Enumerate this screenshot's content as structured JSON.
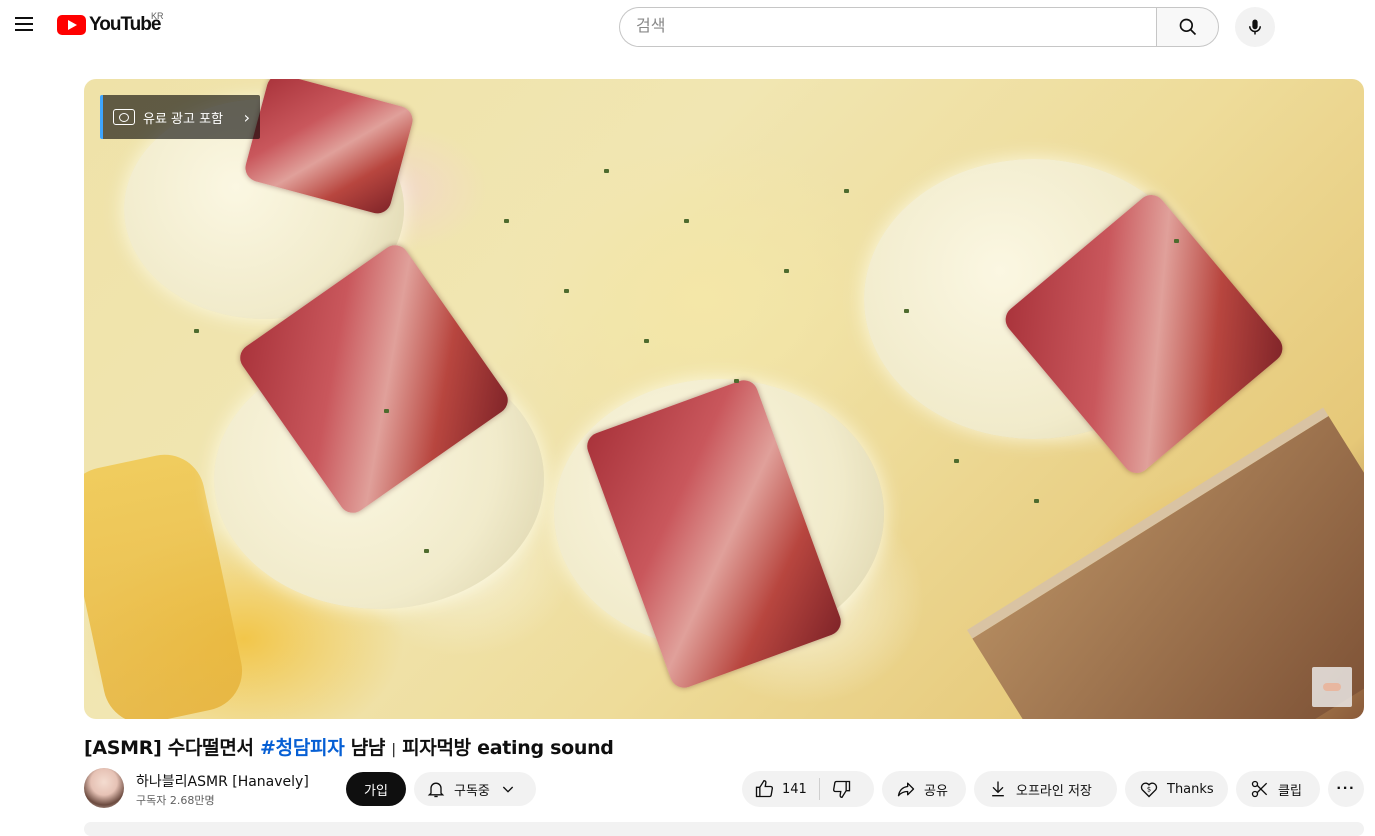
{
  "header": {
    "logo_text": "YouTube",
    "country": "KR",
    "search_placeholder": "검색",
    "search_value": ""
  },
  "player": {
    "ad_badge": "유료 광고 포함"
  },
  "video": {
    "title_prefix": "[ASMR] 수다떨면서 ",
    "title_hashtag": "#청담피자",
    "title_middle": " 냠냠 ",
    "title_sep": "|",
    "title_suffix": " 피자먹방 eating sound"
  },
  "channel": {
    "name": "하나블리ASMR [Hanavely]",
    "subscribers": "구독자 2.68만명",
    "join_label": "가입",
    "subscribe_label": "구독중"
  },
  "actions": {
    "like_count": "141",
    "share_label": "공유",
    "download_label": "오프라인 저장",
    "thanks_label": "Thanks",
    "clip_label": "클립"
  },
  "colors": {
    "brand_red": "#ff0000",
    "link_blue": "#065fd4",
    "pill_bg": "#f2f2f2"
  }
}
